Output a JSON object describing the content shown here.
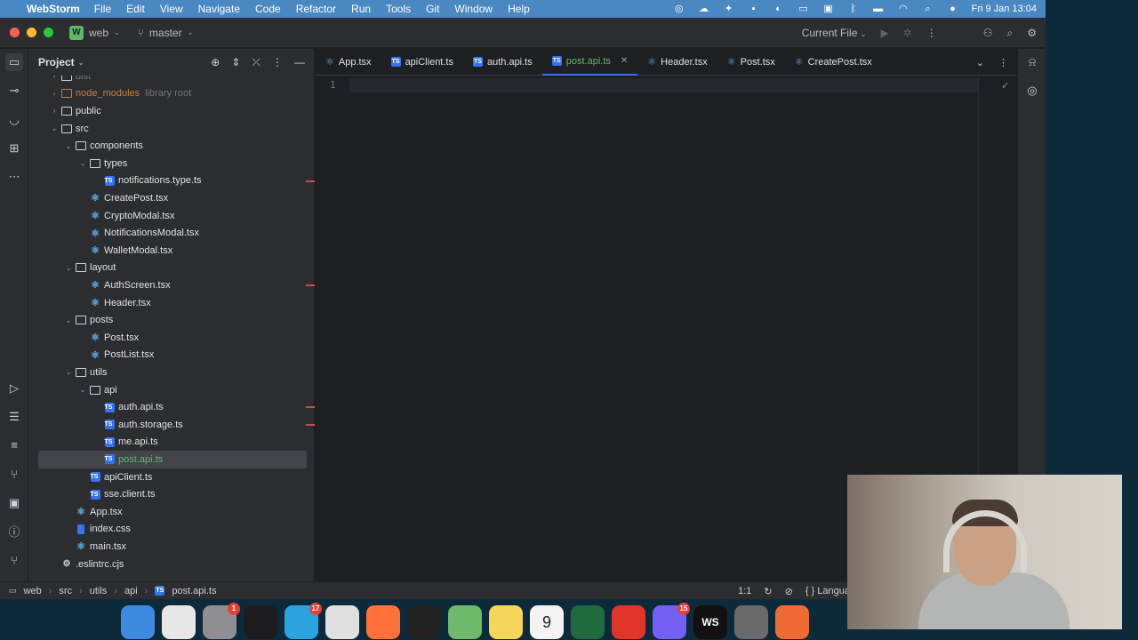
{
  "menubar": {
    "app_name": "WebStorm",
    "items": [
      "File",
      "Edit",
      "View",
      "Navigate",
      "Code",
      "Refactor",
      "Run",
      "Tools",
      "Git",
      "Window",
      "Help"
    ],
    "datetime": "Fri 9 Jan  13:04",
    "status_icons": [
      "tailscale-icon",
      "cloud-icon",
      "bird-icon",
      "chat-icon",
      "vpn-icon",
      "keyboard-icon",
      "us-layout-icon",
      "bluetooth-icon",
      "battery-icon",
      "wifi-icon",
      "search-icon",
      "siri-icon"
    ]
  },
  "titlebar": {
    "project_badge": "W",
    "project_name": "web",
    "branch": "master",
    "run_config": "Current File"
  },
  "project_panel": {
    "title": "Project",
    "tree": [
      {
        "label": "dist",
        "type": "folder",
        "depth": 2,
        "expanded": false,
        "clipped": true
      },
      {
        "label": "node_modules",
        "suffix": "library root",
        "type": "folder-lib",
        "depth": 2,
        "expanded": false
      },
      {
        "label": "public",
        "type": "folder",
        "depth": 2
      },
      {
        "label": "src",
        "type": "folder",
        "depth": 2,
        "expanded": true
      },
      {
        "label": "components",
        "type": "folder",
        "depth": 3,
        "expanded": true
      },
      {
        "label": "types",
        "type": "folder",
        "depth": 4,
        "expanded": true
      },
      {
        "label": "notifications.type.ts",
        "type": "ts",
        "depth": 5,
        "error": true
      },
      {
        "label": "CreatePost.tsx",
        "type": "tsx",
        "depth": 4
      },
      {
        "label": "CryptoModal.tsx",
        "type": "tsx",
        "depth": 4
      },
      {
        "label": "NotificationsModal.tsx",
        "type": "tsx",
        "depth": 4
      },
      {
        "label": "WalletModal.tsx",
        "type": "tsx",
        "depth": 4
      },
      {
        "label": "layout",
        "type": "folder",
        "depth": 3,
        "expanded": true
      },
      {
        "label": "AuthScreen.tsx",
        "type": "tsx",
        "depth": 4,
        "error": true
      },
      {
        "label": "Header.tsx",
        "type": "tsx",
        "depth": 4
      },
      {
        "label": "posts",
        "type": "folder",
        "depth": 3,
        "expanded": true
      },
      {
        "label": "Post.tsx",
        "type": "tsx",
        "depth": 4
      },
      {
        "label": "PostList.tsx",
        "type": "tsx",
        "depth": 4
      },
      {
        "label": "utils",
        "type": "folder",
        "depth": 3,
        "expanded": true
      },
      {
        "label": "api",
        "type": "folder",
        "depth": 4,
        "expanded": true
      },
      {
        "label": "auth.api.ts",
        "type": "ts",
        "depth": 5,
        "error": true
      },
      {
        "label": "auth.storage.ts",
        "type": "ts",
        "depth": 5,
        "error": true
      },
      {
        "label": "me.api.ts",
        "type": "ts",
        "depth": 5
      },
      {
        "label": "post.api.ts",
        "type": "ts",
        "depth": 5,
        "selected": true
      },
      {
        "label": "apiClient.ts",
        "type": "ts",
        "depth": 4
      },
      {
        "label": "sse.client.ts",
        "type": "ts",
        "depth": 4
      },
      {
        "label": "App.tsx",
        "type": "tsx",
        "depth": 3
      },
      {
        "label": "index.css",
        "type": "css",
        "depth": 3
      },
      {
        "label": "main.tsx",
        "type": "tsx",
        "depth": 3
      },
      {
        "label": ".eslintrc.cjs",
        "type": "config",
        "depth": 2
      }
    ]
  },
  "tabs": [
    {
      "label": "App.tsx",
      "kind": "tsx"
    },
    {
      "label": "apiClient.ts",
      "kind": "ts"
    },
    {
      "label": "auth.api.ts",
      "kind": "ts"
    },
    {
      "label": "post.api.ts",
      "kind": "ts",
      "active": true
    },
    {
      "label": "Header.tsx",
      "kind": "tsx"
    },
    {
      "label": "Post.tsx",
      "kind": "tsx"
    },
    {
      "label": "CreatePost.tsx",
      "kind": "tsx"
    }
  ],
  "editor": {
    "line_number": "1"
  },
  "statusbar": {
    "breadcrumb": [
      "web",
      "src",
      "utils",
      "api",
      "post.api.ts"
    ],
    "cursor": "1:1",
    "language": "{ } Langua"
  },
  "dock": {
    "apps": [
      {
        "name": "finder",
        "color": "#3d8be0",
        "badge": ""
      },
      {
        "name": "launchpad",
        "color": "#e7e7e7",
        "badge": ""
      },
      {
        "name": "system-settings",
        "color": "#8e8e93",
        "badge": "1"
      },
      {
        "name": "terminal",
        "color": "#1c1c1e",
        "badge": ""
      },
      {
        "name": "telegram",
        "color": "#2aa3df",
        "badge": "17"
      },
      {
        "name": "chrome",
        "color": "#e0e0e0",
        "badge": ""
      },
      {
        "name": "firefox",
        "color": "#ff7139",
        "badge": ""
      },
      {
        "name": "activity-monitor",
        "color": "#222",
        "badge": ""
      },
      {
        "name": "atom",
        "color": "#6fb96a",
        "badge": ""
      },
      {
        "name": "notes",
        "color": "#f5d55a",
        "badge": ""
      },
      {
        "name": "calendar",
        "color": "#f3f3f3",
        "badge": "",
        "text": "9"
      },
      {
        "name": "mongodb-compass",
        "color": "#1f6b3d",
        "badge": ""
      },
      {
        "name": "readdle",
        "color": "#e1352b",
        "badge": ""
      },
      {
        "name": "viber",
        "color": "#7360f2",
        "badge": "15"
      },
      {
        "name": "webstorm",
        "color": "#111",
        "badge": "",
        "text": "WS"
      },
      {
        "name": "sequel",
        "color": "#6a6a6a",
        "badge": ""
      },
      {
        "name": "draw",
        "color": "#f06a35",
        "badge": ""
      }
    ]
  }
}
